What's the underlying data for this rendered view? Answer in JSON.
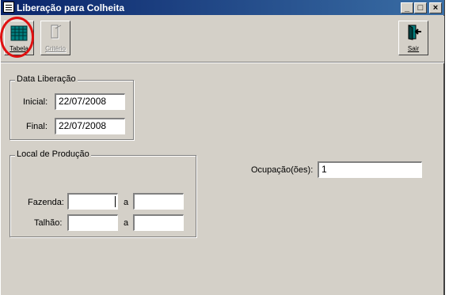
{
  "window": {
    "title": "Liberação para Colheita",
    "controls": [
      "_",
      "□",
      "×"
    ]
  },
  "toolbar": {
    "tabela_label": "Tabela",
    "criterio_label": "Critério",
    "sair_label": "Sair"
  },
  "data_liberacao": {
    "title": "Data Liberação",
    "inicial_label": "Inicial:",
    "inicial_value": "22/07/2008",
    "final_label": "Final:",
    "final_value": "22/07/2008"
  },
  "local_producao": {
    "title": "Local de Produção",
    "fazenda_label": "Fazenda:",
    "fazenda_from": "",
    "fazenda_sep": "a",
    "fazenda_to": "",
    "talhao_label": "Talhão:",
    "talhao_from": "",
    "talhao_sep": "a",
    "talhao_to": ""
  },
  "ocupacao": {
    "label": "Ocupação(ões):",
    "value": "1"
  },
  "colors": {
    "titlebar_start": "#0a246a",
    "titlebar_end": "#3a6ea5",
    "window_bg": "#d4d0c8",
    "annotation_circle": "#e01010"
  }
}
